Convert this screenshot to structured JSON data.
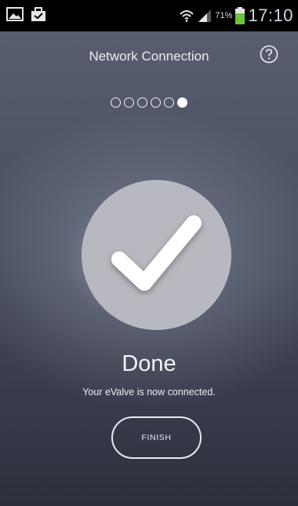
{
  "status_bar": {
    "battery_percent": "71%",
    "time": "17:10",
    "icons": [
      "picture-icon",
      "briefcase-icon",
      "wifi-icon",
      "signal-icon",
      "battery-icon"
    ]
  },
  "header": {
    "title": "Network Connection",
    "help_icon": "question-circle-icon"
  },
  "steps": {
    "total": 6,
    "current": 6
  },
  "status": {
    "icon": "checkmark-icon",
    "title": "Done",
    "message": "Your eValve is now connected."
  },
  "actions": {
    "finish_label": "FINISH"
  },
  "colors": {
    "battery_fill": "#6cc43a",
    "circle_fill": "#b8b9c0",
    "check_color": "#ffffff"
  }
}
